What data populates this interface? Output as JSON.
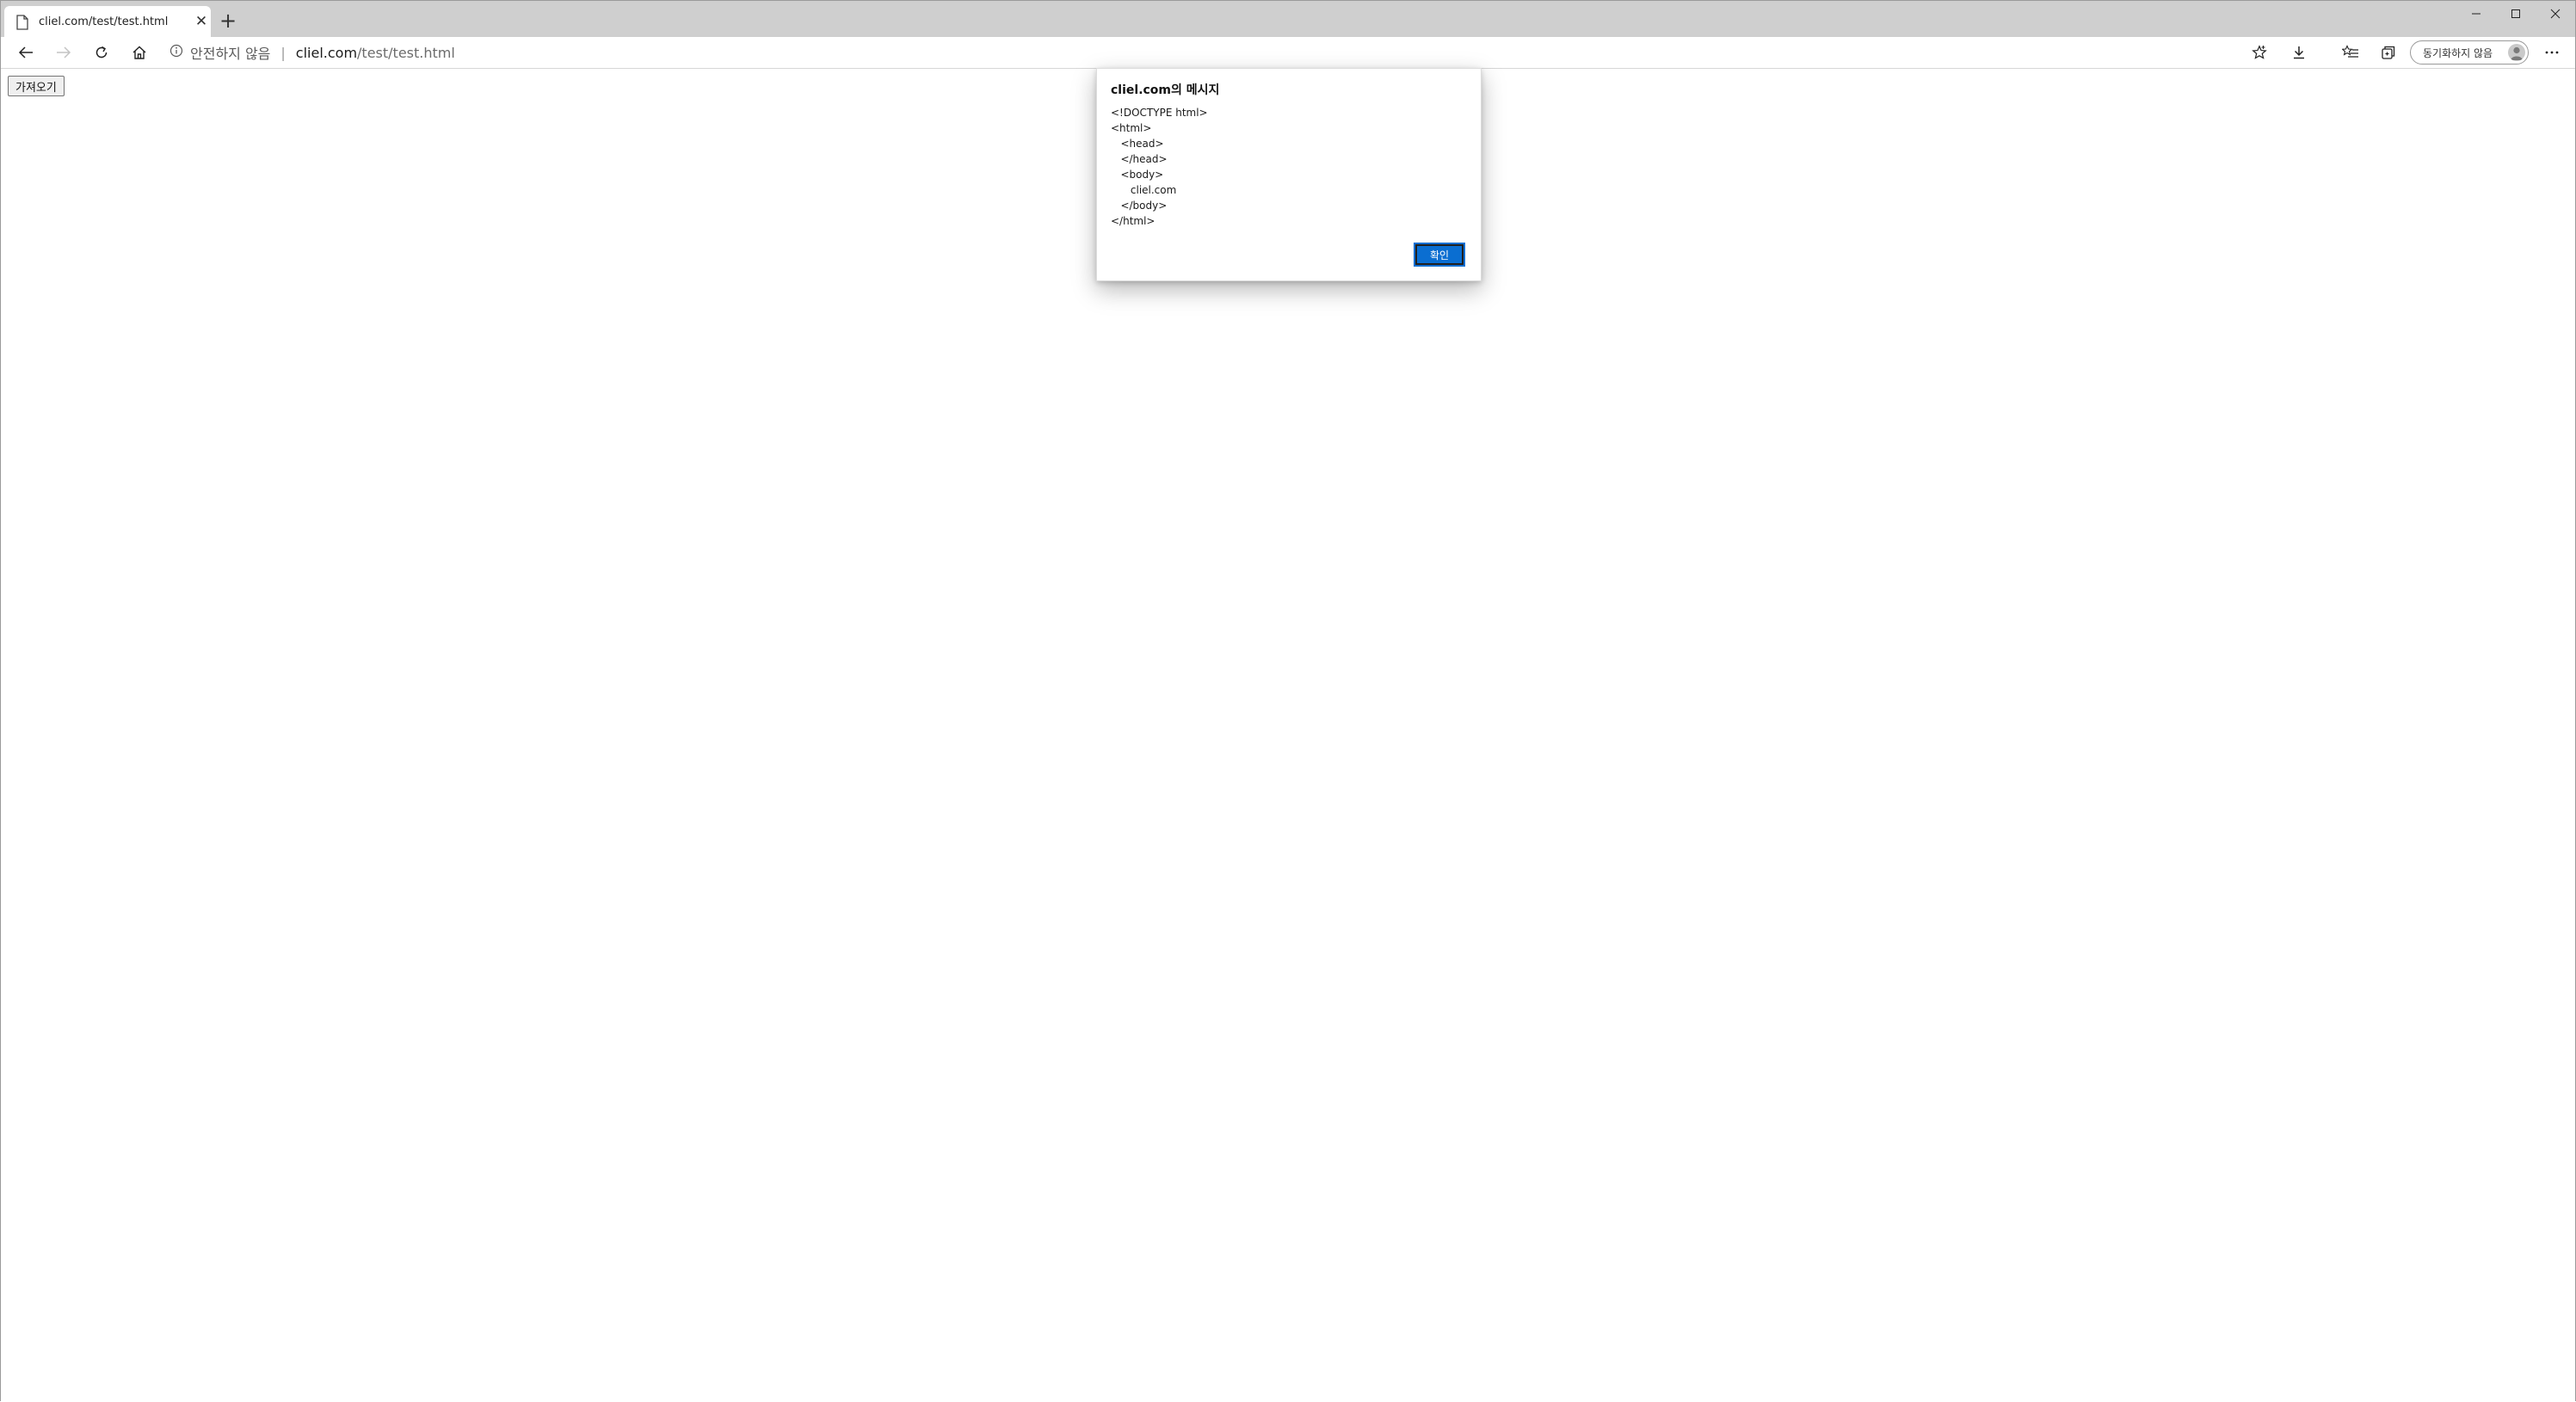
{
  "tab": {
    "title": "cliel.com/test/test.html",
    "close_glyph": "✕",
    "new_tab_glyph": "+"
  },
  "window_controls": {
    "minimize": "—",
    "maximize": "☐",
    "close": "✕"
  },
  "address_bar": {
    "security_text": "안전하지 않음",
    "separator": "|",
    "host": "cliel.com",
    "path": "/test/test.html"
  },
  "sync": {
    "label": "동기화하지 않음"
  },
  "page": {
    "fetch_button_label": "가져오기"
  },
  "dialog": {
    "title": "cliel.com의 메시지",
    "message_lines": [
      "<!DOCTYPE html>",
      "<html>",
      "   <head>",
      "   </head>",
      "   <body>",
      "      cliel.com",
      "   </body>",
      "</html>"
    ],
    "ok_label": "확인"
  },
  "colors": {
    "accent": "#0a6ed1",
    "tabstrip": "#cfcfcf"
  }
}
